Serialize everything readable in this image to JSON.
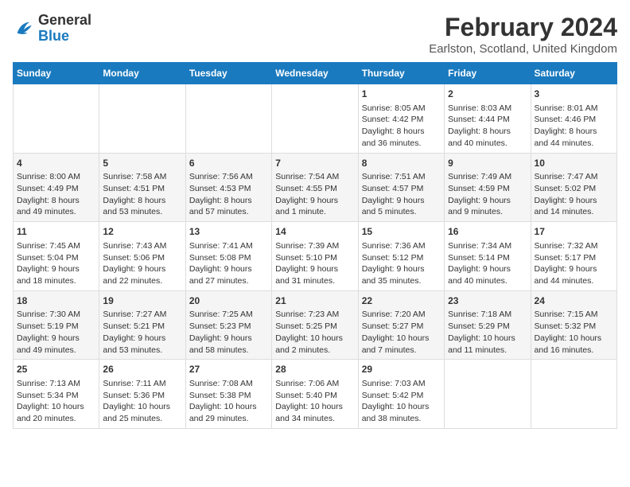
{
  "header": {
    "logo_general": "General",
    "logo_blue": "Blue",
    "title": "February 2024",
    "subtitle": "Earlston, Scotland, United Kingdom"
  },
  "days_of_week": [
    "Sunday",
    "Monday",
    "Tuesday",
    "Wednesday",
    "Thursday",
    "Friday",
    "Saturday"
  ],
  "weeks": [
    [
      {
        "day": "",
        "content": ""
      },
      {
        "day": "",
        "content": ""
      },
      {
        "day": "",
        "content": ""
      },
      {
        "day": "",
        "content": ""
      },
      {
        "day": "1",
        "content": "Sunrise: 8:05 AM\nSunset: 4:42 PM\nDaylight: 8 hours\nand 36 minutes."
      },
      {
        "day": "2",
        "content": "Sunrise: 8:03 AM\nSunset: 4:44 PM\nDaylight: 8 hours\nand 40 minutes."
      },
      {
        "day": "3",
        "content": "Sunrise: 8:01 AM\nSunset: 4:46 PM\nDaylight: 8 hours\nand 44 minutes."
      }
    ],
    [
      {
        "day": "4",
        "content": "Sunrise: 8:00 AM\nSunset: 4:49 PM\nDaylight: 8 hours\nand 49 minutes."
      },
      {
        "day": "5",
        "content": "Sunrise: 7:58 AM\nSunset: 4:51 PM\nDaylight: 8 hours\nand 53 minutes."
      },
      {
        "day": "6",
        "content": "Sunrise: 7:56 AM\nSunset: 4:53 PM\nDaylight: 8 hours\nand 57 minutes."
      },
      {
        "day": "7",
        "content": "Sunrise: 7:54 AM\nSunset: 4:55 PM\nDaylight: 9 hours\nand 1 minute."
      },
      {
        "day": "8",
        "content": "Sunrise: 7:51 AM\nSunset: 4:57 PM\nDaylight: 9 hours\nand 5 minutes."
      },
      {
        "day": "9",
        "content": "Sunrise: 7:49 AM\nSunset: 4:59 PM\nDaylight: 9 hours\nand 9 minutes."
      },
      {
        "day": "10",
        "content": "Sunrise: 7:47 AM\nSunset: 5:02 PM\nDaylight: 9 hours\nand 14 minutes."
      }
    ],
    [
      {
        "day": "11",
        "content": "Sunrise: 7:45 AM\nSunset: 5:04 PM\nDaylight: 9 hours\nand 18 minutes."
      },
      {
        "day": "12",
        "content": "Sunrise: 7:43 AM\nSunset: 5:06 PM\nDaylight: 9 hours\nand 22 minutes."
      },
      {
        "day": "13",
        "content": "Sunrise: 7:41 AM\nSunset: 5:08 PM\nDaylight: 9 hours\nand 27 minutes."
      },
      {
        "day": "14",
        "content": "Sunrise: 7:39 AM\nSunset: 5:10 PM\nDaylight: 9 hours\nand 31 minutes."
      },
      {
        "day": "15",
        "content": "Sunrise: 7:36 AM\nSunset: 5:12 PM\nDaylight: 9 hours\nand 35 minutes."
      },
      {
        "day": "16",
        "content": "Sunrise: 7:34 AM\nSunset: 5:14 PM\nDaylight: 9 hours\nand 40 minutes."
      },
      {
        "day": "17",
        "content": "Sunrise: 7:32 AM\nSunset: 5:17 PM\nDaylight: 9 hours\nand 44 minutes."
      }
    ],
    [
      {
        "day": "18",
        "content": "Sunrise: 7:30 AM\nSunset: 5:19 PM\nDaylight: 9 hours\nand 49 minutes."
      },
      {
        "day": "19",
        "content": "Sunrise: 7:27 AM\nSunset: 5:21 PM\nDaylight: 9 hours\nand 53 minutes."
      },
      {
        "day": "20",
        "content": "Sunrise: 7:25 AM\nSunset: 5:23 PM\nDaylight: 9 hours\nand 58 minutes."
      },
      {
        "day": "21",
        "content": "Sunrise: 7:23 AM\nSunset: 5:25 PM\nDaylight: 10 hours\nand 2 minutes."
      },
      {
        "day": "22",
        "content": "Sunrise: 7:20 AM\nSunset: 5:27 PM\nDaylight: 10 hours\nand 7 minutes."
      },
      {
        "day": "23",
        "content": "Sunrise: 7:18 AM\nSunset: 5:29 PM\nDaylight: 10 hours\nand 11 minutes."
      },
      {
        "day": "24",
        "content": "Sunrise: 7:15 AM\nSunset: 5:32 PM\nDaylight: 10 hours\nand 16 minutes."
      }
    ],
    [
      {
        "day": "25",
        "content": "Sunrise: 7:13 AM\nSunset: 5:34 PM\nDaylight: 10 hours\nand 20 minutes."
      },
      {
        "day": "26",
        "content": "Sunrise: 7:11 AM\nSunset: 5:36 PM\nDaylight: 10 hours\nand 25 minutes."
      },
      {
        "day": "27",
        "content": "Sunrise: 7:08 AM\nSunset: 5:38 PM\nDaylight: 10 hours\nand 29 minutes."
      },
      {
        "day": "28",
        "content": "Sunrise: 7:06 AM\nSunset: 5:40 PM\nDaylight: 10 hours\nand 34 minutes."
      },
      {
        "day": "29",
        "content": "Sunrise: 7:03 AM\nSunset: 5:42 PM\nDaylight: 10 hours\nand 38 minutes."
      },
      {
        "day": "",
        "content": ""
      },
      {
        "day": "",
        "content": ""
      }
    ]
  ]
}
